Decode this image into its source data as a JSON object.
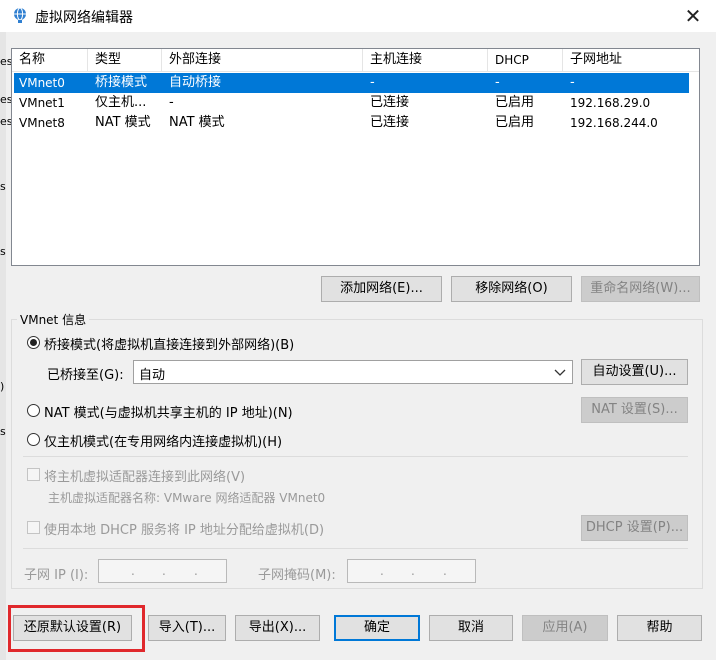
{
  "window": {
    "title": "虚拟网络编辑器",
    "close_symbol": "✕"
  },
  "left_fragments": [
    "es",
    "es",
    "es",
    "s",
    "s",
    ")",
    "s"
  ],
  "table": {
    "headers": [
      "名称",
      "类型",
      "外部连接",
      "主机连接",
      "DHCP",
      "子网地址"
    ],
    "rows": [
      {
        "name": "VMnet0",
        "type": "桥接模式",
        "external": "自动桥接",
        "host": "-",
        "dhcp": "-",
        "subnet": "-",
        "selected": true
      },
      {
        "name": "VMnet1",
        "type": "仅主机...",
        "external": "-",
        "host": "已连接",
        "dhcp": "已启用",
        "subnet": "192.168.29.0",
        "selected": false
      },
      {
        "name": "VMnet8",
        "type": "NAT 模式",
        "external": "NAT 模式",
        "host": "已连接",
        "dhcp": "已启用",
        "subnet": "192.168.244.0",
        "selected": false
      }
    ]
  },
  "network_buttons": {
    "add": "添加网络(E)...",
    "remove": "移除网络(O)",
    "rename": "重命名网络(W)..."
  },
  "vmnet_info": {
    "group_label": "VMnet 信息",
    "bridged_label": "桥接模式(将虚拟机直接连接到外部网络)(B)",
    "bridged_to_label": "已桥接至(G):",
    "bridged_to_value": "自动",
    "auto_settings": "自动设置(U)...",
    "nat_label": "NAT 模式(与虚拟机共享主机的 IP 地址)(N)",
    "nat_settings": "NAT 设置(S)...",
    "hostonly_label": "仅主机模式(在专用网络内连接虚拟机)(H)",
    "connect_adapter_label": "将主机虚拟适配器连接到此网络(V)",
    "adapter_name_label": "主机虚拟适配器名称: VMware 网络适配器 VMnet0",
    "dhcp_label": "使用本地 DHCP 服务将 IP 地址分配给虚拟机(D)",
    "dhcp_settings": "DHCP 设置(P)...",
    "subnet_ip_label": "子网 IP (I):",
    "subnet_mask_label": "子网掩码(M):",
    "ip_dot": "."
  },
  "bottom_buttons": {
    "restore": "还原默认设置(R)",
    "import": "导入(T)...",
    "export": "导出(X)...",
    "ok": "确定",
    "cancel": "取消",
    "apply": "应用(A)",
    "help": "帮助"
  },
  "colors": {
    "selection": "#0078d7",
    "highlight_box": "#e0282c"
  }
}
